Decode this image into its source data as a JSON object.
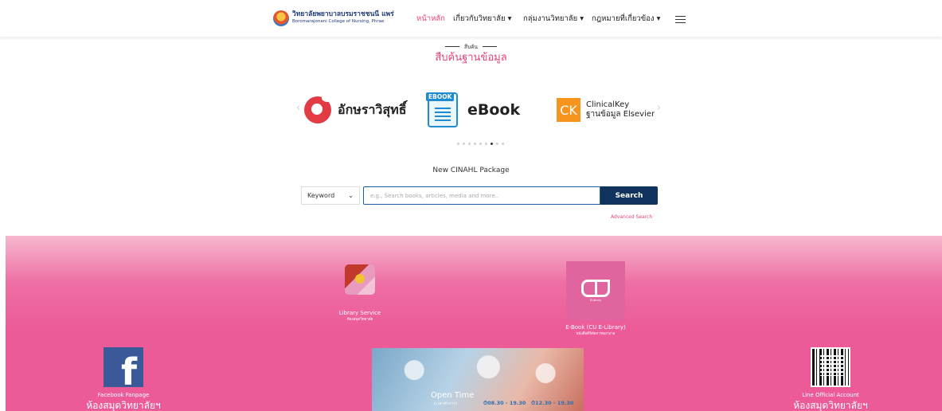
{
  "header": {
    "logo_th": "วิทยาลัยพยาบาลบรมราชชนนี แพร่",
    "logo_en": "Boromarajonani College of Nursing, Phrae",
    "nav": [
      {
        "label": "หน้าหลัก",
        "active": true
      },
      {
        "label": "เกี่ยวกับวิทยาลัย ▾",
        "active": false
      },
      {
        "label": "กลุ่มงานวิทยาลัย ▾",
        "active": false
      },
      {
        "label": "กฎหมายที่เกี่ยวข้อง ▾",
        "active": false
      }
    ]
  },
  "section": {
    "small_label": "สืบค้น",
    "title": "สืบค้นฐานข้อมูล"
  },
  "carousel": {
    "prev": "‹",
    "next": "›",
    "akson": "อักษราวิสุทธิ์",
    "ebook_tag": "EBOOK",
    "ebook": "eBook",
    "ck_abbr": "CK",
    "ck_line1": "ClinicalKey",
    "ck_line2": "ฐานข้อมูล Elsevier",
    "dot_count": 9,
    "active_dot": 7
  },
  "search": {
    "package_title": "New CINAHL Package",
    "select_value": "Keyword",
    "placeholder": "e.g., Search books, articles, media and more..",
    "button": "Search",
    "advanced": "Advanced Search"
  },
  "footer": {
    "library_label": "Library Service",
    "library_sub": "ห้องสมุดวิทยาลัย",
    "ebook_label": "E-Book (CU E-Library)",
    "ebook_sub": "หนังสือดิจิทัลการพยาบาล",
    "ebook_tile_sub": "ELibrary",
    "facebook_label": "Facebook Fanpage",
    "facebook_big": "ห้องสมุดวิทยาลัยฯ",
    "line_label": "Line Official Account",
    "line_big": "ห้องสมุดวิทยาลัยฯ",
    "banner_title": "Open Time",
    "banner_sub": "(เวลาทำการ)",
    "banner_time1": "⏱08.30 - 19.30",
    "banner_time2": "⏱12.30 - 19.30"
  },
  "colors": {
    "accent_pink": "#e2447d",
    "navy": "#10335e",
    "footer_pink": "#ec5a97"
  }
}
